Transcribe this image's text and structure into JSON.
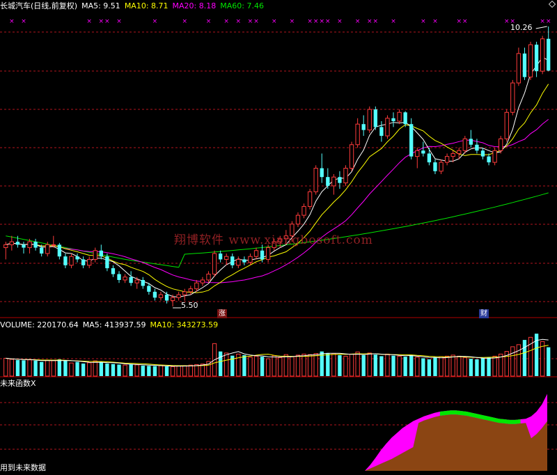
{
  "colors": {
    "up": "#ff3b3b",
    "down": "#54ffff",
    "ma5": "#ffffff",
    "ma10": "#ffff00",
    "ma20": "#ff00ff",
    "ma60": "#00e600",
    "grid": "#b4141e",
    "watermark": "#a8262a"
  },
  "main_panel": {
    "title": "长城汽车(日线,前复权)",
    "ma5": "MA5: 9.51",
    "ma10": "MA10: 8.71",
    "ma20": "MA20: 8.18",
    "ma60": "MA60: 7.46",
    "high_label": "10.26",
    "low_label": "5.50",
    "event_mark_1": "涨",
    "event_mark_2": "财",
    "watermark": "翔博软件 www.xiangbosoft.com",
    "corner_icon": "diamond-icon"
  },
  "volume_panel": {
    "volume": "VOLUME: 220170.64",
    "ma5": "MA5: 413937.59",
    "ma10": "MA10: 343273.59"
  },
  "indicator_panel": {
    "title": "未来函数X",
    "footer": "用到未来数据"
  },
  "chart_data": {
    "type": "candlestick",
    "title": "长城汽车(日线,前复权)",
    "price_high": 10.26,
    "price_low": 5.5,
    "ma_last": {
      "MA5": 9.51,
      "MA10": 8.71,
      "MA20": 8.18,
      "MA60": 7.46
    },
    "volume_last": 220170.64,
    "volume_ma_last": {
      "MA5": 413937.59,
      "MA10": 343273.59
    },
    "candles": [
      [
        6.5,
        6.6,
        6.3,
        6.55
      ],
      [
        6.55,
        6.7,
        6.45,
        6.6
      ],
      [
        6.6,
        6.7,
        6.5,
        6.55
      ],
      [
        6.55,
        6.6,
        6.4,
        6.5
      ],
      [
        6.5,
        6.65,
        6.4,
        6.6
      ],
      [
        6.6,
        6.65,
        6.45,
        6.5
      ],
      [
        6.5,
        6.55,
        6.35,
        6.4
      ],
      [
        6.4,
        6.6,
        6.35,
        6.55
      ],
      [
        6.55,
        6.7,
        6.5,
        6.55
      ],
      [
        6.55,
        6.58,
        6.3,
        6.35
      ],
      [
        6.35,
        6.4,
        6.15,
        6.2
      ],
      [
        6.2,
        6.4,
        6.15,
        6.35
      ],
      [
        6.35,
        6.4,
        6.25,
        6.3
      ],
      [
        6.3,
        6.35,
        6.15,
        6.2
      ],
      [
        6.2,
        6.35,
        6.15,
        6.3
      ],
      [
        6.3,
        6.5,
        6.25,
        6.45
      ],
      [
        6.45,
        6.55,
        6.3,
        6.35
      ],
      [
        6.35,
        6.4,
        6.1,
        6.15
      ],
      [
        6.15,
        6.2,
        6.0,
        6.05
      ],
      [
        6.05,
        6.1,
        5.9,
        5.95
      ],
      [
        5.95,
        6.05,
        5.9,
        6.0
      ],
      [
        6.0,
        6.1,
        5.85,
        5.9
      ],
      [
        5.9,
        6.0,
        5.8,
        5.95
      ],
      [
        5.95,
        6.0,
        5.8,
        5.85
      ],
      [
        5.85,
        5.9,
        5.7,
        5.75
      ],
      [
        5.75,
        5.8,
        5.6,
        5.65
      ],
      [
        5.65,
        5.75,
        5.6,
        5.7
      ],
      [
        5.7,
        5.75,
        5.55,
        5.6
      ],
      [
        5.6,
        5.7,
        5.5,
        5.65
      ],
      [
        5.65,
        5.75,
        5.6,
        5.7
      ],
      [
        5.7,
        5.8,
        5.6,
        5.75
      ],
      [
        5.75,
        5.85,
        5.7,
        5.8
      ],
      [
        5.8,
        5.95,
        5.75,
        5.9
      ],
      [
        5.9,
        6.0,
        5.85,
        5.95
      ],
      [
        5.95,
        6.1,
        5.9,
        6.05
      ],
      [
        6.05,
        6.45,
        6.0,
        6.4
      ],
      [
        6.4,
        6.45,
        6.25,
        6.3
      ],
      [
        6.3,
        6.4,
        6.2,
        6.35
      ],
      [
        6.35,
        6.4,
        6.15,
        6.2
      ],
      [
        6.2,
        6.35,
        6.15,
        6.3
      ],
      [
        6.3,
        6.35,
        6.2,
        6.25
      ],
      [
        6.25,
        6.4,
        6.2,
        6.35
      ],
      [
        6.35,
        6.5,
        6.3,
        6.45
      ],
      [
        6.45,
        6.55,
        6.25,
        6.3
      ],
      [
        6.3,
        6.55,
        6.25,
        6.5
      ],
      [
        6.5,
        6.65,
        6.45,
        6.6
      ],
      [
        6.6,
        6.7,
        6.5,
        6.65
      ],
      [
        6.65,
        6.8,
        6.55,
        6.7
      ],
      [
        6.7,
        6.95,
        6.6,
        6.9
      ],
      [
        6.9,
        7.1,
        6.85,
        7.05
      ],
      [
        7.05,
        7.25,
        7.0,
        7.2
      ],
      [
        7.2,
        7.5,
        7.15,
        7.45
      ],
      [
        7.45,
        7.9,
        7.4,
        7.85
      ],
      [
        7.85,
        8.1,
        7.6,
        7.7
      ],
      [
        7.7,
        7.85,
        7.5,
        7.55
      ],
      [
        7.55,
        7.75,
        7.4,
        7.7
      ],
      [
        7.7,
        7.8,
        7.5,
        7.6
      ],
      [
        7.6,
        7.9,
        7.55,
        7.85
      ],
      [
        7.85,
        8.3,
        7.8,
        8.25
      ],
      [
        8.25,
        8.7,
        8.2,
        8.6
      ],
      [
        8.6,
        8.75,
        8.4,
        8.5
      ],
      [
        8.5,
        8.9,
        8.45,
        8.85
      ],
      [
        8.85,
        8.9,
        8.5,
        8.55
      ],
      [
        8.55,
        8.65,
        8.3,
        8.4
      ],
      [
        8.4,
        8.75,
        8.35,
        8.7
      ],
      [
        8.7,
        8.8,
        8.55,
        8.65
      ],
      [
        8.65,
        8.85,
        8.6,
        8.8
      ],
      [
        8.8,
        8.82,
        8.55,
        8.6
      ],
      [
        8.6,
        8.7,
        8.0,
        8.05
      ],
      [
        8.05,
        8.2,
        7.85,
        8.15
      ],
      [
        8.15,
        8.3,
        8.05,
        8.1
      ],
      [
        8.1,
        8.2,
        7.9,
        7.95
      ],
      [
        7.95,
        8.0,
        7.75,
        7.8
      ],
      [
        7.8,
        8.0,
        7.75,
        7.95
      ],
      [
        7.95,
        8.1,
        7.9,
        8.05
      ],
      [
        8.05,
        8.15,
        7.95,
        8.1
      ],
      [
        8.1,
        8.2,
        8.0,
        8.15
      ],
      [
        8.15,
        8.4,
        8.1,
        8.35
      ],
      [
        8.35,
        8.5,
        8.2,
        8.25
      ],
      [
        8.25,
        8.35,
        8.1,
        8.15
      ],
      [
        8.15,
        8.2,
        8.0,
        8.05
      ],
      [
        8.05,
        8.1,
        7.9,
        7.95
      ],
      [
        7.95,
        8.2,
        7.9,
        8.15
      ],
      [
        8.15,
        8.4,
        8.1,
        8.35
      ],
      [
        8.35,
        8.85,
        8.3,
        8.8
      ],
      [
        8.8,
        9.35,
        8.75,
        9.3
      ],
      [
        9.3,
        9.9,
        9.25,
        9.8
      ],
      [
        9.8,
        9.9,
        9.35,
        9.4
      ],
      [
        9.4,
        10.0,
        9.35,
        9.95
      ],
      [
        9.95,
        10.0,
        9.4,
        9.5
      ],
      [
        9.5,
        10.1,
        9.45,
        10.05
      ],
      [
        10.05,
        10.26,
        9.5,
        9.51
      ]
    ],
    "volume": [
      340,
      320,
      305,
      300,
      310,
      295,
      270,
      305,
      295,
      320,
      300,
      250,
      270,
      240,
      255,
      290,
      265,
      240,
      230,
      220,
      210,
      230,
      215,
      200,
      195,
      190,
      200,
      185,
      180,
      195,
      200,
      210,
      220,
      230,
      280,
      620,
      470,
      440,
      390,
      420,
      400,
      360,
      380,
      370,
      330,
      390,
      350,
      410,
      370,
      400,
      420,
      410,
      430,
      470,
      440,
      430,
      400,
      380,
      420,
      460,
      400,
      440,
      410,
      380,
      420,
      390,
      380,
      370,
      400,
      360,
      340,
      320,
      360,
      370,
      380,
      400,
      380,
      350,
      330,
      320,
      340,
      360,
      380,
      420,
      470,
      560,
      600,
      690,
      740,
      810,
      660,
      550
    ],
    "indicator_rise": [
      0,
      10,
      22,
      35,
      46,
      56,
      64,
      72,
      78,
      84,
      88,
      92,
      95,
      98,
      100,
      101,
      102,
      102,
      101,
      100,
      98,
      96,
      94,
      92,
      90,
      88,
      87,
      86,
      86,
      87,
      88,
      92,
      100,
      112,
      130
    ],
    "indicator_cum": [
      0,
      4,
      8,
      12,
      16,
      20,
      25,
      30,
      35,
      40,
      44,
      48,
      52,
      55,
      58,
      60,
      62,
      63,
      62,
      61,
      60,
      58,
      56,
      54,
      52,
      50,
      49,
      48,
      48,
      49,
      50,
      55,
      62,
      72,
      84
    ]
  }
}
